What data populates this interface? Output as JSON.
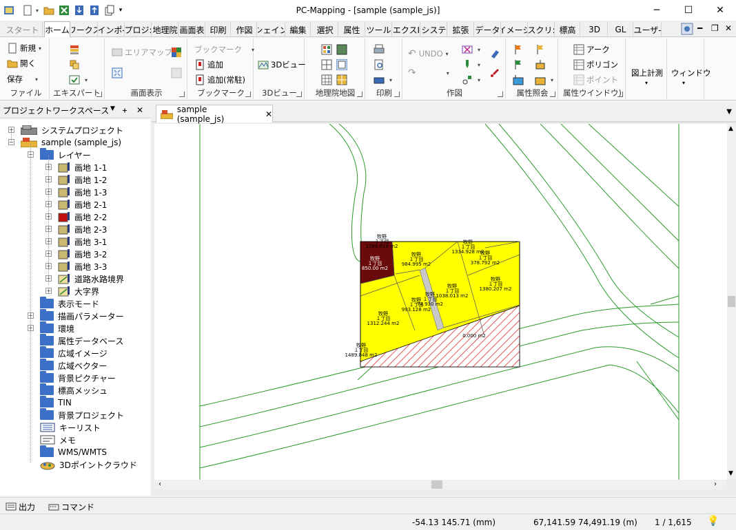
{
  "window": {
    "title": "PC-Mapping - [sample (sample_js)]",
    "minimize": "─",
    "maximize": "☐",
    "close": "✕"
  },
  "ribbon_tabs": [
    {
      "label": "スタート"
    },
    {
      "label": "ホーム"
    },
    {
      "label": "ワークス"
    },
    {
      "label": "インポ-"
    },
    {
      "label": "プロジ:"
    },
    {
      "label": "地理院"
    },
    {
      "label": "画面表"
    },
    {
      "label": "印刷"
    },
    {
      "label": "作図"
    },
    {
      "label": "シェイン"
    },
    {
      "label": "編集"
    },
    {
      "label": "選択"
    },
    {
      "label": "属性"
    },
    {
      "label": "ツール"
    },
    {
      "label": "エクスI"
    },
    {
      "label": "システ"
    },
    {
      "label": "拡張"
    },
    {
      "label": "データ"
    },
    {
      "label": "イメーシ"
    },
    {
      "label": "スクリ:"
    },
    {
      "label": "標高"
    },
    {
      "label": "3D"
    },
    {
      "label": "GL"
    },
    {
      "label": "ユーザ-"
    }
  ],
  "ribbon": {
    "file": {
      "label": "ファイル",
      "new": "新規",
      "open": "開く",
      "save": "保存"
    },
    "expert": {
      "label": "エキスパート"
    },
    "display": {
      "label": "画面表示",
      "area_map": "エリアマップ"
    },
    "bookmark": {
      "label": "ブックマーク",
      "bookmark_dropdown": "ブックマーク",
      "add": "追加",
      "add_always": "追加(常駐)"
    },
    "view3d": {
      "label": "3Dビュー",
      "button": "3Dビュー"
    },
    "gsi": {
      "label": "地理院地図"
    },
    "print": {
      "label": "印刷"
    },
    "draw": {
      "label": "作図",
      "undo": "UNDO"
    },
    "attr_ref": {
      "label": "属性照会"
    },
    "attr_win": {
      "label": "属性ウインドウ)",
      "arc": "アーク",
      "polygon": "ポリゴン",
      "point": "ポイント"
    },
    "measure": {
      "label": "図上計測"
    },
    "window": {
      "label": "ウィンドウ"
    }
  },
  "panel": {
    "title": "プロジェクトワークスペース",
    "pin": "ᚐ",
    "close": "✕"
  },
  "tree": {
    "system_project": "システムプロジェクト",
    "project": "sample (sample_js)",
    "layer": "レイヤー",
    "layers": [
      {
        "label": "画地 1-1"
      },
      {
        "label": "画地 1-2"
      },
      {
        "label": "画地 1-3"
      },
      {
        "label": "画地 2-1"
      },
      {
        "label": "画地 2-2"
      },
      {
        "label": "画地 2-3"
      },
      {
        "label": "画地 3-1"
      },
      {
        "label": "画地 3-2"
      },
      {
        "label": "画地 3-3"
      },
      {
        "label": "道路水路境界"
      },
      {
        "label": "大字界"
      }
    ],
    "folders": [
      {
        "label": "表示モード"
      },
      {
        "label": "描画パラメーター"
      },
      {
        "label": "環境"
      },
      {
        "label": "属性データベース"
      },
      {
        "label": "広域イメージ"
      },
      {
        "label": "広域ベクター"
      },
      {
        "label": "背景ピクチャー"
      },
      {
        "label": "標高メッシュ"
      },
      {
        "label": "TIN"
      },
      {
        "label": "背景プロジェクト"
      }
    ],
    "keylist": "キーリスト",
    "memo": "メモ",
    "wms": "WMS/WMTS",
    "pointcloud": "3Dポイントクラウド"
  },
  "doc": {
    "tab_label": "sample (sample_js)",
    "tab_close": "✕"
  },
  "map_labels": {
    "area1": "牧野\n１丁目\n1289.819 m2",
    "area2": "牧野\n１丁目\n984.995 m2",
    "area3": "牧野\n１丁目\n1334.928 m2",
    "area4": "牧野\n１丁目\n378.792 m2",
    "area5": "牧野\n１丁目\n1380.207 m2",
    "area6": "牧野\n１丁目\n1038.013 m2",
    "area7": "牧野\n１丁目\n74.930 m2",
    "area8": "牧野\n１丁目\n993.128 m2",
    "area9": "牧野\n１丁目\n1312.244 m2",
    "area10": "牧野\n１丁目\n1489.848 m2",
    "area11": "0.000 m2",
    "maroon": "牧野\n１丁目\n850.00 m2"
  },
  "bottom_tabs": {
    "output": "出力",
    "command": "コマンド"
  },
  "status": {
    "mm": "-54.13 145.71 (mm)",
    "m": "67,141.59 74,491.19 (m)",
    "scale": "1 / 1,615"
  }
}
